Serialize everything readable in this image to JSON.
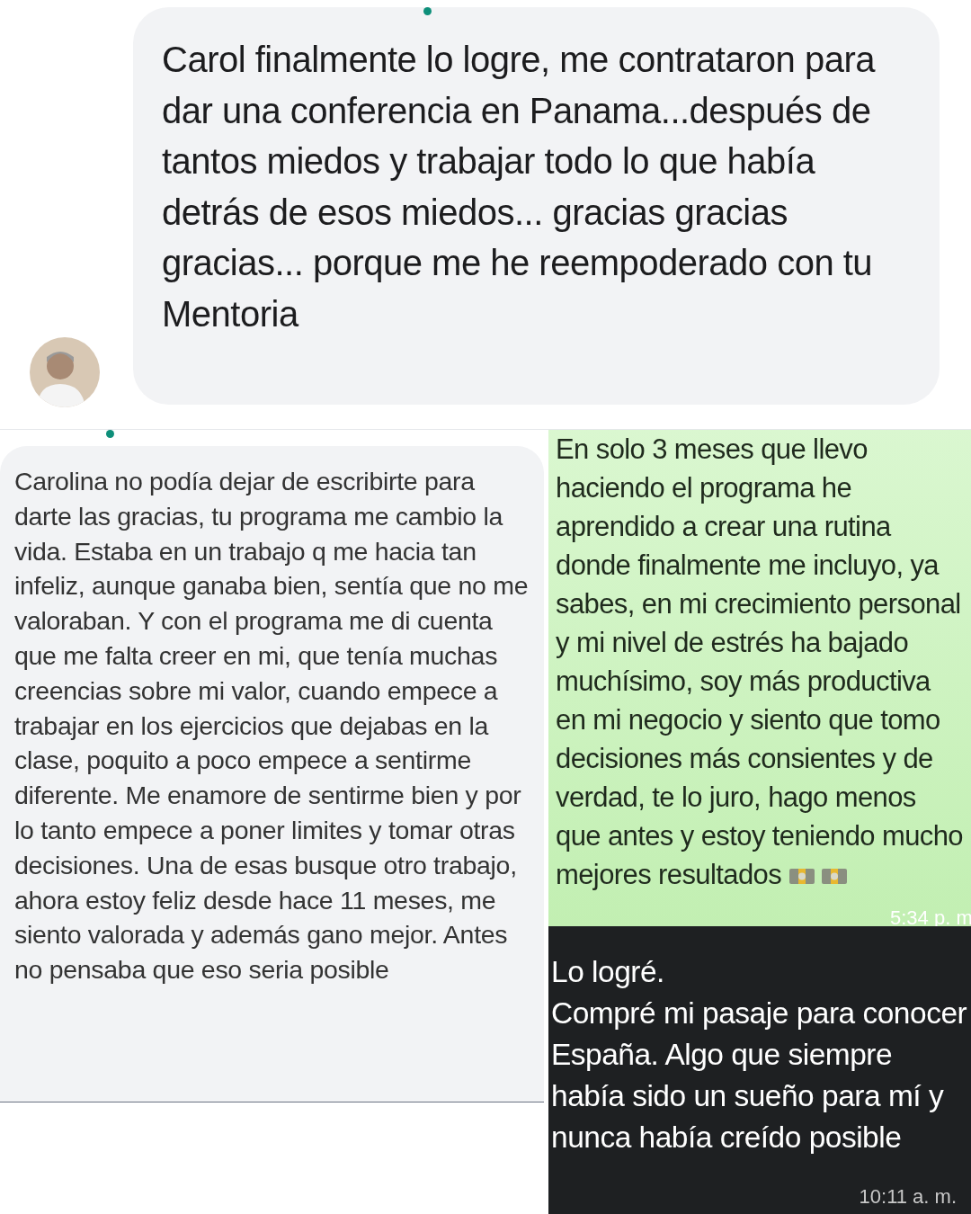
{
  "top_chat": {
    "message": "Carol finalmente lo logre, me contrataron para dar una conferencia en Panama...después de tantos miedos y trabajar todo lo que había detrás de esos miedos... gracias gracias gracias... porque me he reempoderado con tu Mentoria"
  },
  "left_chat": {
    "message": "Carolina no podía dejar de escribirte para darte las gracias, tu programa me cambio la vida. Estaba en un trabajo q me hacia tan infeliz, aunque ganaba bien, sentía que no me valoraban. Y con el programa me di cuenta que me falta creer en mi, que tenía muchas creencias sobre mi valor, cuando empece a trabajar en los ejercicios que dejabas en la clase, poquito a poco empece a sentirme diferente. Me enamore de sentirme bien y por lo tanto empece a poner limites y tomar otras decisiones. Una de esas busque otro trabajo, ahora estoy feliz desde hace 11 meses, me siento valorada y además gano mejor. Antes no pensaba que eso seria posible"
  },
  "green_chat": {
    "message": "En solo 3 meses que llevo haciendo el programa he aprendido a crear una rutina donde finalmente me incluyo, ya sabes, en mi crecimiento personal y mi nivel de estrés ha bajado muchísimo, soy más productiva en mi negocio y siento que tomo decisiones más consientes y de verdad, te lo juro, hago menos que antes y estoy teniendo mucho mejores resultados",
    "time": "5:34 p. m"
  },
  "dark_chat": {
    "message": "Lo logré.\nCompré mi pasaje para conocer España. Algo que siempre había sido un sueño para mí y nunca había creído posible",
    "time": "10:11 a. m."
  }
}
